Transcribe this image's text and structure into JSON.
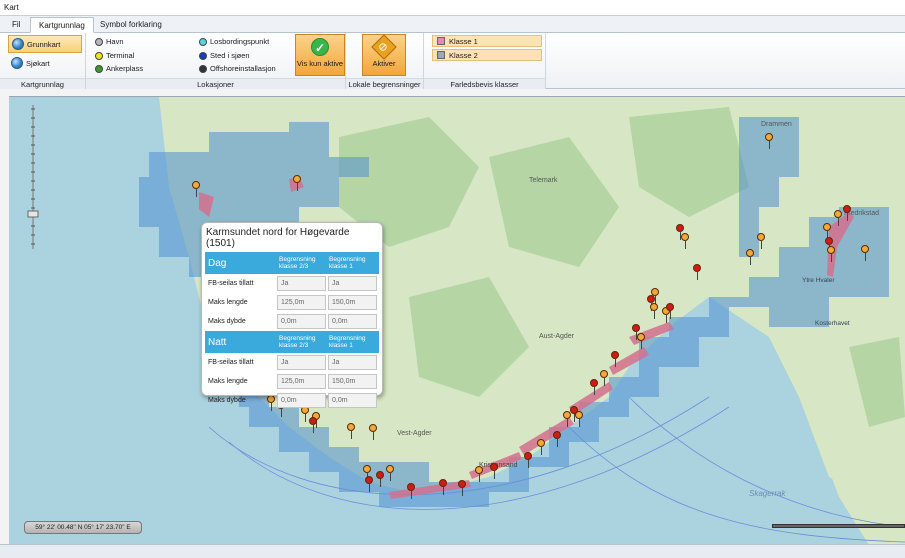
{
  "window": {
    "title": "Kart"
  },
  "tabs": [
    {
      "label": "Fil"
    },
    {
      "label": "Kartgrunnlag"
    },
    {
      "label": "Symbol forklaring"
    }
  ],
  "ribbon": {
    "kartgrunnlag": {
      "group_label": "Kartgrunnlag",
      "grunnkart": "Grunnkart",
      "sjokart": "Sjøkart"
    },
    "lokasjoner": {
      "group_label": "Lokasjoner",
      "items": [
        {
          "label": "Havn",
          "color": "#b8b8b8"
        },
        {
          "label": "Terminal",
          "color": "#f2e21b"
        },
        {
          "label": "Ankerplass",
          "color": "#3a9a2a"
        },
        {
          "label": "Losbordingspunkt",
          "color": "#4fd8e0"
        },
        {
          "label": "Sted i sjøen",
          "color": "#1a3fb0"
        },
        {
          "label": "Offshoreinstallasjon",
          "color": "#333333"
        }
      ],
      "vis_kun_aktive": "Vis kun aktive"
    },
    "lokale_begrensninger": {
      "group_label": "Lokale begrensninger",
      "aktiver": "Aktiver"
    },
    "farledsbevis": {
      "group_label": "Farledsbevis klasser",
      "items": [
        {
          "label": "Klasse 1",
          "color": "#e38ab0"
        },
        {
          "label": "Klasse 2",
          "color": "#9aa8b8"
        }
      ]
    }
  },
  "map": {
    "place_labels": {
      "telemark": "Telemark",
      "aust_agder": "Aust-Agder",
      "vest_agder": "Vest-Agder",
      "drammen": "Drammen",
      "kristiansand": "Kristiansand",
      "fredrikstad": "Fredrikstad",
      "ytre_hvaler": "Ytre Hvaler",
      "kosterhavet": "Kosterhavet",
      "skagerrak": "Skagerrak"
    },
    "coordinates": "59° 22' 00.48\" N 05° 17' 23.70\" E"
  },
  "popup": {
    "title": "Karmsundet nord for Høgevarde (1501)",
    "col_a": "Begrensning klasse 2/3",
    "col_b": "Begrensning klasse 1",
    "sections": [
      {
        "heading": "Dag",
        "rows": [
          {
            "label": "FB-seilas tillatt",
            "a": "Ja",
            "b": "Ja"
          },
          {
            "label": "Maks lengde",
            "a": "125,0m",
            "b": "150,0m"
          },
          {
            "label": "Maks dybde",
            "a": "0,0m",
            "b": "0,0m"
          }
        ]
      },
      {
        "heading": "Natt",
        "rows": [
          {
            "label": "FB-seilas tillatt",
            "a": "Ja",
            "b": "Ja"
          },
          {
            "label": "Maks lengde",
            "a": "125,0m",
            "b": "150,0m"
          },
          {
            "label": "Maks dybde",
            "a": "0,0m",
            "b": "0,0m"
          }
        ]
      }
    ]
  },
  "colors": {
    "accent_tab": "#3aa9dc",
    "active_button": "#f3a63a",
    "sea": "#aad3df",
    "land": "#d7e6c4",
    "coverage": "#4f8fd0",
    "marker_orange": "#f2a93b",
    "marker_red": "#d11a1a"
  }
}
